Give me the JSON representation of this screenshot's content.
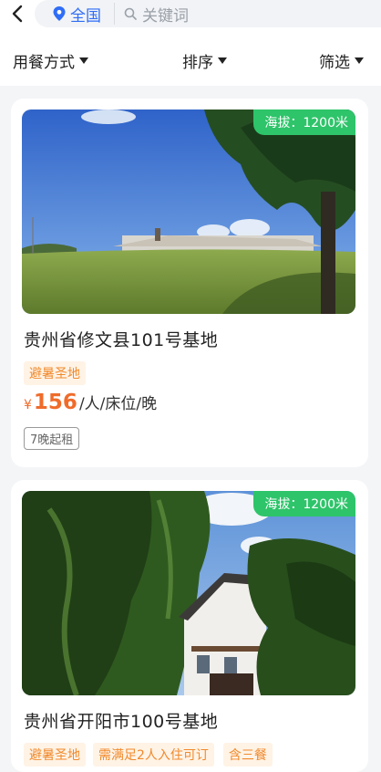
{
  "header": {
    "back_icon": "chevron-left-icon",
    "location_label": "全国",
    "location_icon": "location-pin-icon",
    "search_icon": "search-icon",
    "search_placeholder": "关键词"
  },
  "filters": [
    {
      "label": "用餐方式"
    },
    {
      "label": "排序"
    },
    {
      "label": "筛选"
    }
  ],
  "listings": [
    {
      "altitude": "海拔：1200米",
      "title": "贵州省修文县101号基地",
      "tags": [
        "避暑圣地"
      ],
      "currency": "¥",
      "price": "156",
      "price_unit": "/人/床位/晚",
      "min_stay": "7晚起租"
    },
    {
      "altitude": "海拔：1200米",
      "title": "贵州省开阳市100号基地",
      "tags": [
        "避暑圣地",
        "需满足2人入住可订",
        "含三餐"
      ]
    }
  ],
  "colors": {
    "accent_blue": "#2f6df6",
    "altitude_green": "#2ec46a",
    "price_orange": "#f06b2a",
    "tag_orange": "#f08a2c"
  }
}
